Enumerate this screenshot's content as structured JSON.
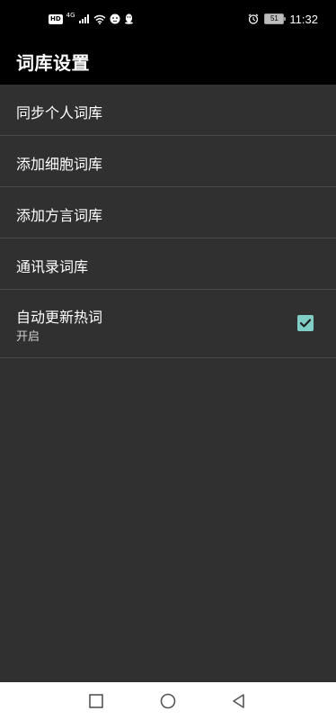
{
  "status_bar": {
    "network_label": "4G",
    "hd_label": "HD",
    "battery_level": "51",
    "time": "11:32",
    "icons": [
      "hd-icon",
      "signal-icon",
      "wifi-icon",
      "cat-app-icon",
      "qq-penguin-icon",
      "alarm-icon",
      "battery-icon"
    ]
  },
  "app_bar": {
    "title": "词库设置"
  },
  "settings": [
    {
      "label": "同步个人词库"
    },
    {
      "label": "添加细胞词库"
    },
    {
      "label": "添加方言词库"
    },
    {
      "label": "通讯录词库"
    },
    {
      "label": "自动更新热词",
      "summary": "开启",
      "checked": true
    }
  ],
  "colors": {
    "background": "#303030",
    "bar": "#000000",
    "divider": "#4a4a4a",
    "checkbox_accent": "#7fcdc4",
    "nav_bar": "#ffffff"
  },
  "nav_bar": {
    "icons": [
      "recent-apps-icon",
      "home-icon",
      "back-icon"
    ]
  }
}
